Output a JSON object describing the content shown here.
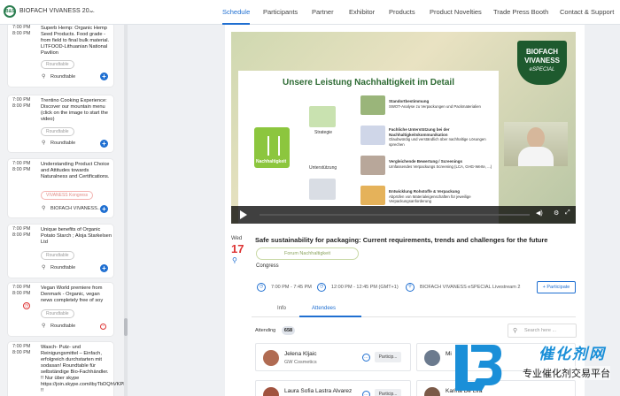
{
  "header": {
    "brand": "BIOFACH VIVANESS 20...",
    "logo_text": "B&S",
    "nav": [
      "Schedule",
      "Participants",
      "Partner",
      "Exhibitor",
      "Products",
      "Product Novelties",
      "Trade Press Booth",
      "Contact & Support"
    ],
    "active": "Schedule"
  },
  "sessions": [
    {
      "start": "7:00 PM",
      "end": "8:00 PM",
      "title": "Superb Hemp: Organic Hemp Seed Products. Food grade - from field to final bulk material. LITFOOD-Lithuanian National Pavilion",
      "tag": "Roundtable",
      "location": "Roundtable",
      "action": "+"
    },
    {
      "start": "7:00 PM",
      "end": "8:00 PM",
      "title": "Trentino Cooking Experience: Discover our mountain menu (click on the image to start the video)",
      "tag": "Roundtable",
      "location": "Roundtable",
      "action": "+"
    },
    {
      "start": "7:00 PM",
      "end": "8:00 PM",
      "title": "Understanding Product Choice and Attitudes towards Naturalness and Certifications.",
      "tag": "VIVANESS Kongress",
      "location": "BIOFACH VIVANESS...",
      "action": "+"
    },
    {
      "start": "7:00 PM",
      "end": "8:00 PM",
      "title": "Unique benefits of Organic Potato Starch ; Aloja Starkelsen Ltd",
      "tag": "Roundtable",
      "location": "Roundtable",
      "action": "+"
    },
    {
      "start": "7:00 PM",
      "end": "8:00 PM",
      "title": "Vegan World premiere from Denmark - Organic, vegan news completely free of soy",
      "tag": "Roundtable",
      "location": "Roundtable",
      "action": "-"
    },
    {
      "start": "7:00 PM",
      "end": "8:00 PM",
      "title": "Wasch- Putz- und Reinigungsmittel – Einfach, erfolgreich durchstarten mit sodasan! Roundtable für selbständige Bio-Fachhändler. !! Nur über skype https://join.skype.com/ibyTbDQhVKPB !!",
      "tag": "",
      "location": "",
      "action": ""
    }
  ],
  "video": {
    "slide_title": "Unsere Leistung Nachhaltigkeit im Detail",
    "tree_label": "Nachhaltigkeit",
    "strategy_label": "Strategie",
    "support_label": "Unterstützung",
    "bullets": [
      {
        "head": "Standortbestimmung",
        "body": "SWOT-Analyse zu Verpackungen und Packmaterialien"
      },
      {
        "head": "Fachliche Unterstützung bei der Nachhaltigkeitskommunikation",
        "body": "Glaubwürdig und verständlich über nachhaltige Lösungen sprechen"
      },
      {
        "head": "Vergleichende Bewertung / Screenings",
        "body": "Umfassendes Verpackungs Screening (LCA, GHG-Werte, ...)"
      },
      {
        "head": "Entwicklung Rohstoffe & Verpackung",
        "body": "Abprüfen von Materialeigenschaften für jeweilige Verpackungsanforderung"
      }
    ],
    "badge_line1": "BIOFACH",
    "badge_line2": "VIVANESS",
    "badge_line3": "eSPECIAL",
    "time": "43:35"
  },
  "event": {
    "weekday": "Wed",
    "day": "17",
    "title": "Safe sustainability for packaging: Current requirements, trends and challenges for the future",
    "forum": "Forum Nachhaltigkeit",
    "category": "Congress",
    "local_time": "7:00 PM - 7:45 PM",
    "gmt_time": "12:00 PM - 12:45 PM (GMT+1)",
    "location": "BIOFACH VIVANESS eSPECIAL Livestream 2",
    "add_label": "+ Participate"
  },
  "tabs": [
    "Info",
    "Attendees"
  ],
  "attendees": {
    "label": "Attending",
    "count": "658",
    "search_placeholder": "Search here ...",
    "people": [
      {
        "name": "Jelena Kljaic",
        "org": "GW Cosmetics",
        "button": "Particip..."
      },
      {
        "name": "Mi",
        "org": "",
        "button": ""
      },
      {
        "name": "Laura Sofia Lastra Alvarez",
        "org": "",
        "button": "Particip..."
      },
      {
        "name": "Karina De Lira",
        "org": "",
        "button": ""
      }
    ]
  },
  "watermark": {
    "line1": "催化剂网",
    "line2": "专业催化剂交易平台"
  },
  "colors": {
    "accent": "#1f6fd1",
    "date_red": "#d33333",
    "brand_green": "#1e5a2e"
  }
}
